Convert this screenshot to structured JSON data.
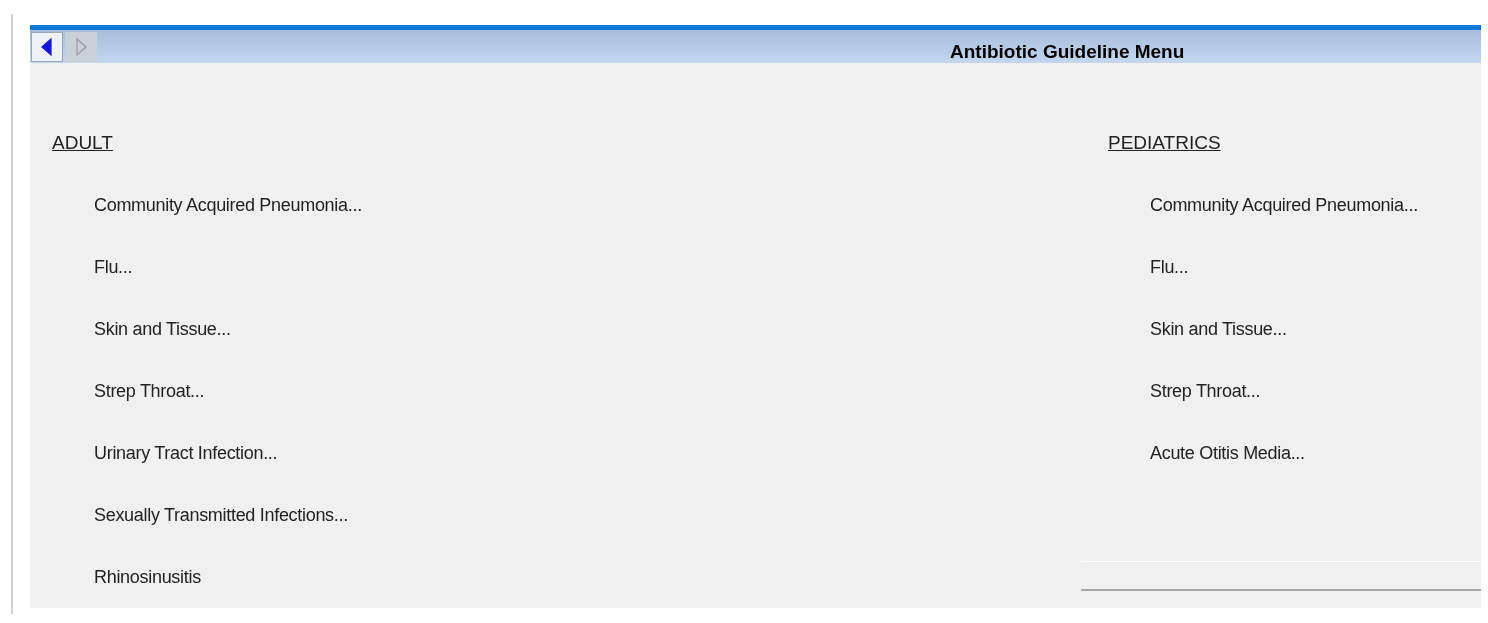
{
  "header": {
    "title": "Antibiotic Guideline Menu",
    "nav_buttons": [
      {
        "kind": "back",
        "disabled": false
      },
      {
        "kind": "forward",
        "disabled": true
      }
    ]
  },
  "sections": [
    {
      "heading": "ADULT",
      "items": [
        "Community Acquired Pneumonia...",
        "Flu...",
        "Skin and Tissue...",
        "Strep Throat...",
        "Urinary Tract Infection...",
        "Sexually Transmitted Infections...",
        "Rhinosinusitis"
      ]
    },
    {
      "heading": "PEDIATRICS",
      "items": [
        "Community Acquired Pneumonia...",
        "Flu...",
        "Skin and Tissue...",
        "Strep Throat...",
        "Acute Otitis Media..."
      ]
    }
  ]
}
